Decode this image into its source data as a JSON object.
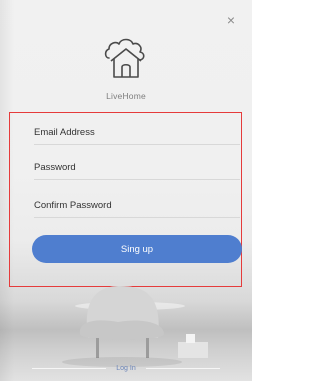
{
  "close": {
    "icon": "close-icon",
    "glyph": "×"
  },
  "brand": {
    "icon": "house-cloud-icon",
    "name": "LiveHome"
  },
  "form": {
    "email_placeholder": "Email Address",
    "password_placeholder": "Password",
    "confirm_placeholder": "Confirm Password",
    "signup_label": "Sing up"
  },
  "footer": {
    "login_label": "Log In"
  },
  "colors": {
    "accent": "#4f7ecf",
    "highlight_border": "#e53b3b"
  }
}
